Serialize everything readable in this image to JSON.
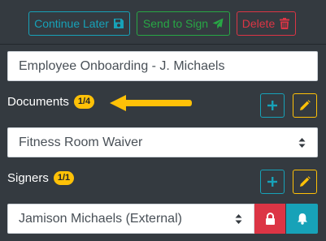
{
  "toolbar": {
    "continue_later": {
      "label": "Continue Later",
      "icon": "save-icon",
      "color": "#17a2b8"
    },
    "send_to_sign": {
      "label": "Send to Sign",
      "icon": "paper-plane-icon",
      "color": "#28a745"
    },
    "delete": {
      "label": "Delete",
      "icon": "trash-icon",
      "color": "#dc3545"
    }
  },
  "envelope": {
    "title_value": "Employee Onboarding - J. Michaels"
  },
  "documents": {
    "label": "Documents",
    "badge": "1/4",
    "selected_document": "Fitness Room Waiver",
    "add_icon": "plus-icon",
    "edit_icon": "pencil-icon",
    "pointer_icon": "arrow-left-icon",
    "pointer_color": "#ffc107"
  },
  "signers": {
    "label": "Signers",
    "badge": "1/1",
    "selected_signer": "Jamison Michaels (External)",
    "add_icon": "plus-icon",
    "edit_icon": "pencil-icon",
    "lock_icon": "lock-icon",
    "notify_icon": "bell-icon",
    "lock_color": "#dc3545",
    "notify_color": "#17a2b8"
  }
}
